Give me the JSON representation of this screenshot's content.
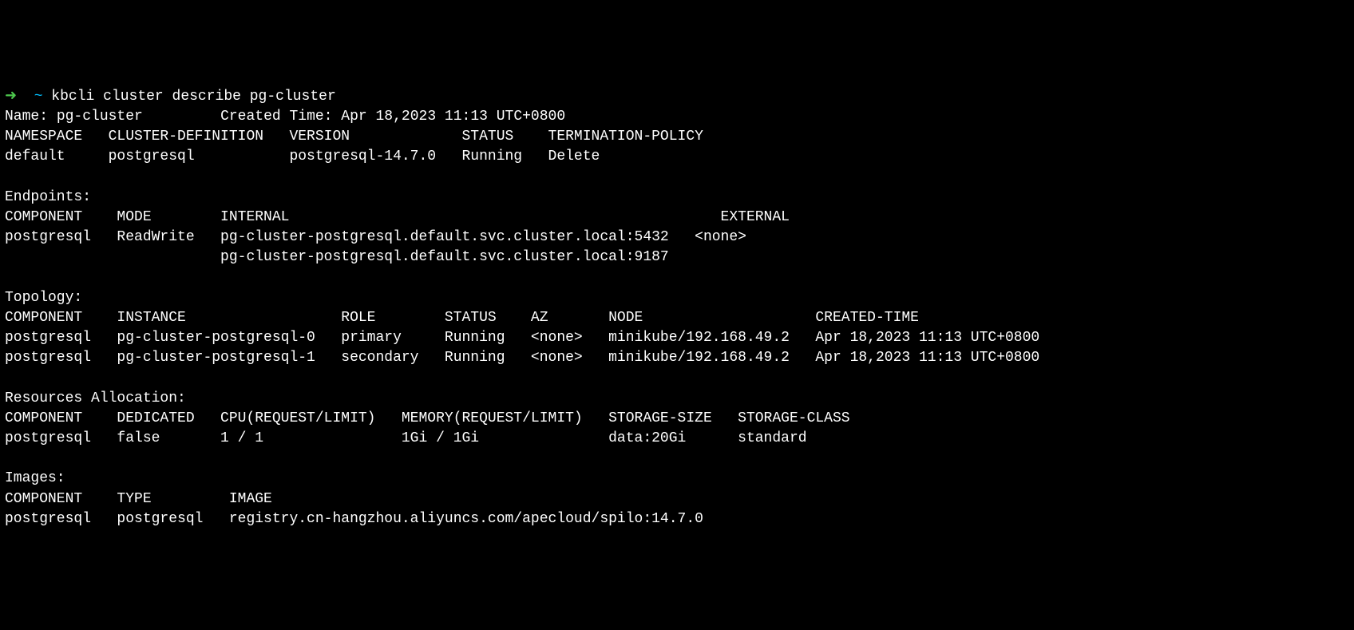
{
  "prompt": {
    "arrow": "➜  ",
    "tilde": "~ ",
    "command": "kbcli cluster describe pg-cluster"
  },
  "header": {
    "name_label": "Name: ",
    "name_value": "pg-cluster",
    "spacing1": "\t ",
    "created_label": "Created Time: ",
    "created_value": "Apr 18,2023 11:13 UTC+0800"
  },
  "summary": {
    "headers": "NAMESPACE   CLUSTER-DEFINITION   VERSION             STATUS    TERMINATION-POLICY   ",
    "row": "default     postgresql           postgresql-14.7.0   Running   Delete               "
  },
  "endpoints": {
    "title": "Endpoints:",
    "headers": "COMPONENT    MODE        INTERNAL                                                  EXTERNAL   ",
    "row1": "postgresql   ReadWrite   pg-cluster-postgresql.default.svc.cluster.local:5432   <none>     ",
    "row2": "                         pg-cluster-postgresql.default.svc.cluster.local:9187              "
  },
  "topology": {
    "title": "Topology:",
    "headers": "COMPONENT    INSTANCE                  ROLE        STATUS    AZ       NODE                    CREATED-TIME                 ",
    "row1": "postgresql   pg-cluster-postgresql-0   primary     Running   <none>   minikube/192.168.49.2   Apr 18,2023 11:13 UTC+0800   ",
    "row2": "postgresql   pg-cluster-postgresql-1   secondary   Running   <none>   minikube/192.168.49.2   Apr 18,2023 11:13 UTC+0800   "
  },
  "resources": {
    "title": "Resources Allocation:",
    "headers": "COMPONENT    DEDICATED   CPU(REQUEST/LIMIT)   MEMORY(REQUEST/LIMIT)   STORAGE-SIZE   STORAGE-CLASS   ",
    "row": "postgresql   false       1 / 1                1Gi / 1Gi               data:20Gi      standard        "
  },
  "images": {
    "title": "Images:",
    "headers": "COMPONENT    TYPE         IMAGE                                                   ",
    "row": "postgresql   postgresql   registry.cn-hangzhou.aliyuncs.com/apecloud/spilo:14.7.0 "
  }
}
